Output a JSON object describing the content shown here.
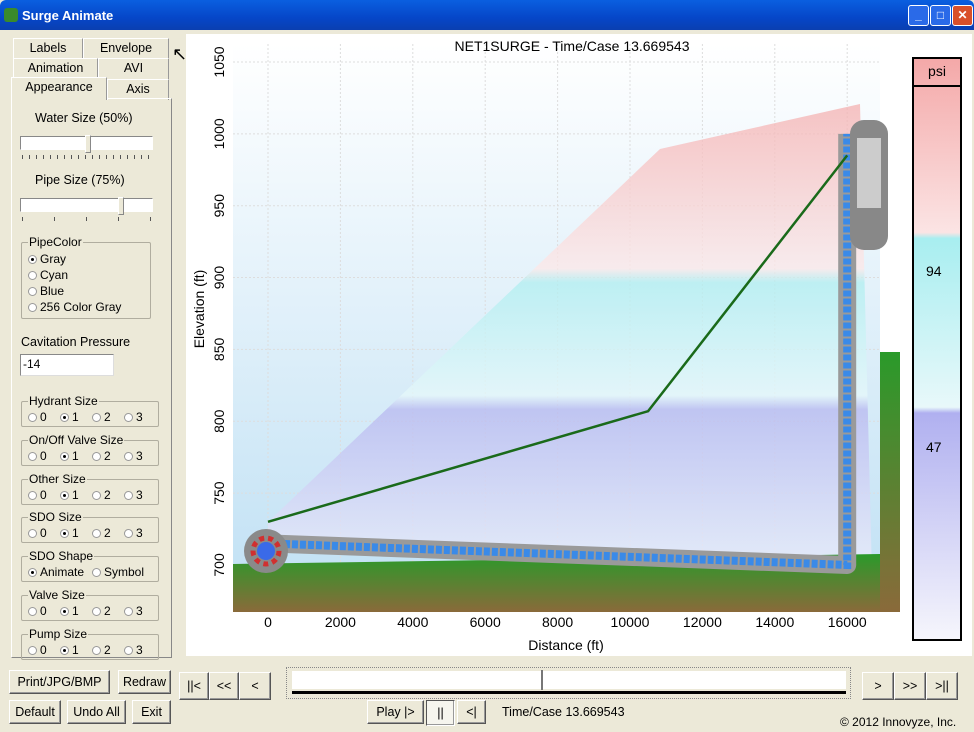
{
  "window": {
    "title": "Surge Animate"
  },
  "tabs": {
    "row1": [
      "Labels",
      "Envelope"
    ],
    "row2": [
      "Animation",
      "AVI"
    ],
    "row3": [
      "Appearance",
      "Axis"
    ],
    "active": "Appearance"
  },
  "appearance": {
    "water_size_label": "Water Size (50%)",
    "water_size_value": 50,
    "pipe_size_label": "Pipe Size  (75%)",
    "pipe_size_value": 75,
    "pipe_color": {
      "title": "PipeColor",
      "options": [
        "Gray",
        "Cyan",
        "Blue",
        "256 Color Gray"
      ],
      "selected": "Gray"
    },
    "cavitation_label": "Cavitation Pressure",
    "cavitation_value": "-14",
    "size_groups": [
      {
        "title": "Hydrant Size",
        "options": [
          "0",
          "1",
          "2",
          "3"
        ],
        "selected": "1"
      },
      {
        "title": "On/Off Valve Size",
        "options": [
          "0",
          "1",
          "2",
          "3"
        ],
        "selected": "1"
      },
      {
        "title": "Other Size",
        "options": [
          "0",
          "1",
          "2",
          "3"
        ],
        "selected": "1"
      },
      {
        "title": "SDO Size",
        "options": [
          "0",
          "1",
          "2",
          "3"
        ],
        "selected": "1"
      }
    ],
    "sdo_shape": {
      "title": "SDO Shape",
      "options": [
        "Animate",
        "Symbol"
      ],
      "selected": "Animate"
    },
    "valve_size": {
      "title": "Valve Size",
      "options": [
        "0",
        "1",
        "2",
        "3"
      ],
      "selected": "1"
    },
    "pump_size": {
      "title": "Pump Size",
      "options": [
        "0",
        "1",
        "2",
        "3"
      ],
      "selected": "1"
    }
  },
  "buttons": {
    "print": "Print/JPG/BMP",
    "redraw": "Redraw",
    "default": "Default",
    "undo": "Undo All",
    "exit": "Exit"
  },
  "playback": {
    "first": "||<",
    "rewind": "<<",
    "back": "<",
    "forward": ">",
    "fast_forward": ">>",
    "last": ">||",
    "play": "Play  |>",
    "pause": "||",
    "reverse": "<|",
    "status": "Time/Case 13.669543",
    "position_fraction": 0.45
  },
  "copyright": "© 2012 Innovyze, Inc.",
  "chart_data": {
    "type": "line",
    "title": "NET1SURGE - Time/Case 13.669543",
    "xlabel": "Distance (ft)",
    "ylabel": "Elevation (ft)",
    "xlim": [
      -900,
      16800
    ],
    "ylim": [
      665,
      1050
    ],
    "xticks": [
      0,
      2000,
      4000,
      6000,
      8000,
      10000,
      12000,
      14000,
      16000
    ],
    "yticks": [
      700,
      750,
      800,
      850,
      900,
      950,
      1000,
      1050
    ],
    "grid": true,
    "series": [
      {
        "role": "hydraulic-grade-line",
        "color": "#1a6a1a",
        "x": [
          0,
          10500,
          16000
        ],
        "y": [
          730,
          807,
          985
        ]
      },
      {
        "role": "pipe-profile",
        "color": "#888888",
        "x": [
          0,
          16000,
          16000
        ],
        "y": [
          715,
          700,
          1000
        ]
      }
    ],
    "legend": {
      "title": "psi",
      "labels": [
        "94",
        "47"
      ],
      "colors": [
        "#f4b0b0",
        "#b0eef0",
        "#b0b0f0"
      ]
    }
  }
}
